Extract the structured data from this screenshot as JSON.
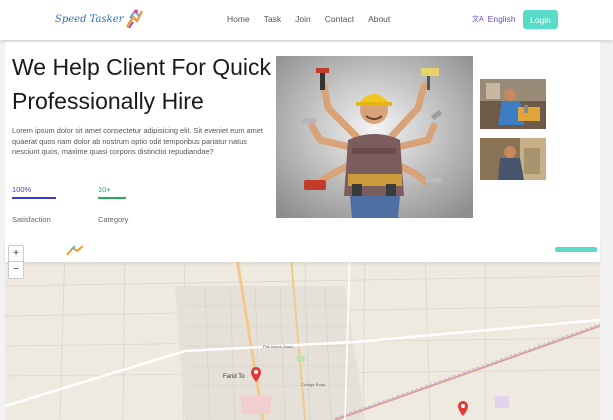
{
  "brand": {
    "name": "Speed Tasker"
  },
  "nav": {
    "links": [
      "Home",
      "Task",
      "Join",
      "Contact",
      "About"
    ],
    "language": "English",
    "login": "Login"
  },
  "hero": {
    "title": "We Help Client For Quick Professionally Hire",
    "paragraph": "Lorem ipsum dolor sit amet consectetur adipisicing elit. Sit eveniet eum amet quaerat quos nam dolor ab nostrum optio odit temporibus pariatur natus nesciunt quos, maxime quasi corporis distinctio repudiandae?",
    "stats": [
      {
        "value": "100%",
        "label": "Satisfaction",
        "color": "#3b3bd6"
      },
      {
        "value": "10+",
        "label": "Category",
        "color": "#27a85a"
      }
    ]
  },
  "map": {
    "places": [
      "Farid To",
      "Pak Attock Road",
      "College Road"
    ],
    "zoom_in": "+",
    "zoom_out": "−"
  },
  "colors": {
    "accent": "#58dcc8",
    "brand_blue": "#2e6fb8",
    "lang_purple": "#6a4bc9"
  }
}
